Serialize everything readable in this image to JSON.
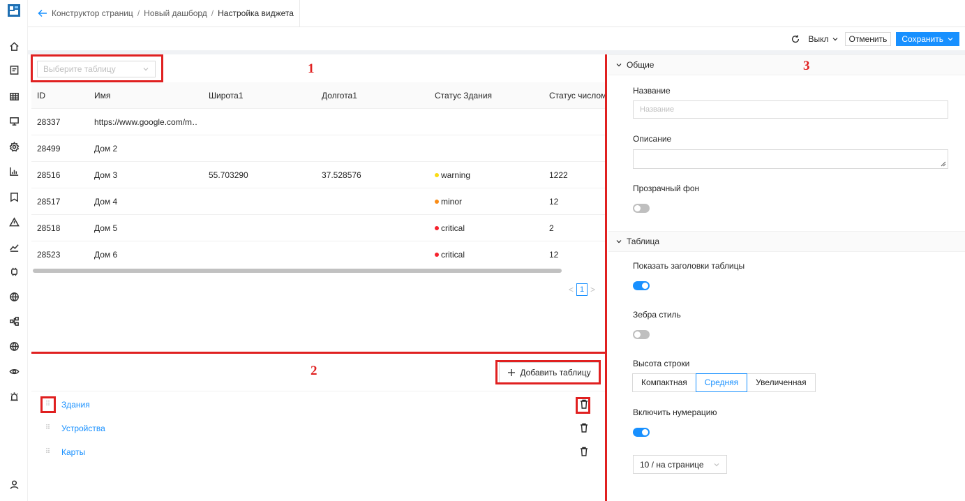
{
  "breadcrumb": {
    "items": [
      "Конструктор страниц",
      "Новый дашборд"
    ],
    "separator": "/",
    "current": "Настройка виджета"
  },
  "toolbar": {
    "toggle_label": "Выкл",
    "cancel_label": "Отменить",
    "save_label": "Сохранить"
  },
  "table_panel": {
    "select_placeholder": "Выберите таблицу",
    "columns": [
      "ID",
      "Имя",
      "Широта1",
      "Долгота1",
      "Статус Здания",
      "Статус числом"
    ],
    "rows": [
      {
        "id": "28337",
        "name": "https://www.google.com/m…",
        "lat": "",
        "lon": "",
        "status": "",
        "status_color": "",
        "num": ""
      },
      {
        "id": "28499",
        "name": "Дом 2",
        "lat": "",
        "lon": "",
        "status": "",
        "status_color": "",
        "num": ""
      },
      {
        "id": "28516",
        "name": "Дом 3",
        "lat": "55.703290",
        "lon": "37.528576",
        "status": "warning",
        "status_color": "#fadb14",
        "num": "1222"
      },
      {
        "id": "28517",
        "name": "Дом 4",
        "lat": "",
        "lon": "",
        "status": "minor",
        "status_color": "#fa8c16",
        "num": "12"
      },
      {
        "id": "28518",
        "name": "Дом 5",
        "lat": "",
        "lon": "",
        "status": "critical",
        "status_color": "#f5222d",
        "num": "2"
      },
      {
        "id": "28523",
        "name": "Дом 6",
        "lat": "",
        "lon": "",
        "status": "critical",
        "status_color": "#f5222d",
        "num": "12"
      }
    ],
    "pagination": {
      "current_page": "1",
      "prev": "<",
      "next": ">"
    }
  },
  "tables_list": {
    "add_label": "Добавить таблицу",
    "items": [
      "Здания",
      "Устройства",
      "Карты"
    ]
  },
  "settings": {
    "general": {
      "title": "Общие",
      "name_label": "Название",
      "name_placeholder": "Название",
      "description_label": "Описание",
      "transparent_label": "Прозрачный фон",
      "transparent_on": false
    },
    "table": {
      "title": "Таблица",
      "show_headers_label": "Показать заголовки таблицы",
      "show_headers_on": true,
      "zebra_label": "Зебра стиль",
      "zebra_on": false,
      "row_height_label": "Высота строки",
      "row_height_options": [
        "Компактная",
        "Средняя",
        "Увеличенная"
      ],
      "row_height_selected": "Средняя",
      "numbering_label": "Включить нумерацию",
      "numbering_on": true,
      "page_size_value": "10 / на странице"
    }
  },
  "annotations": [
    "1",
    "2",
    "3"
  ],
  "colors": {
    "accent": "#1890ff",
    "annotation": "#e02020",
    "logo": "#1f6fb2"
  }
}
